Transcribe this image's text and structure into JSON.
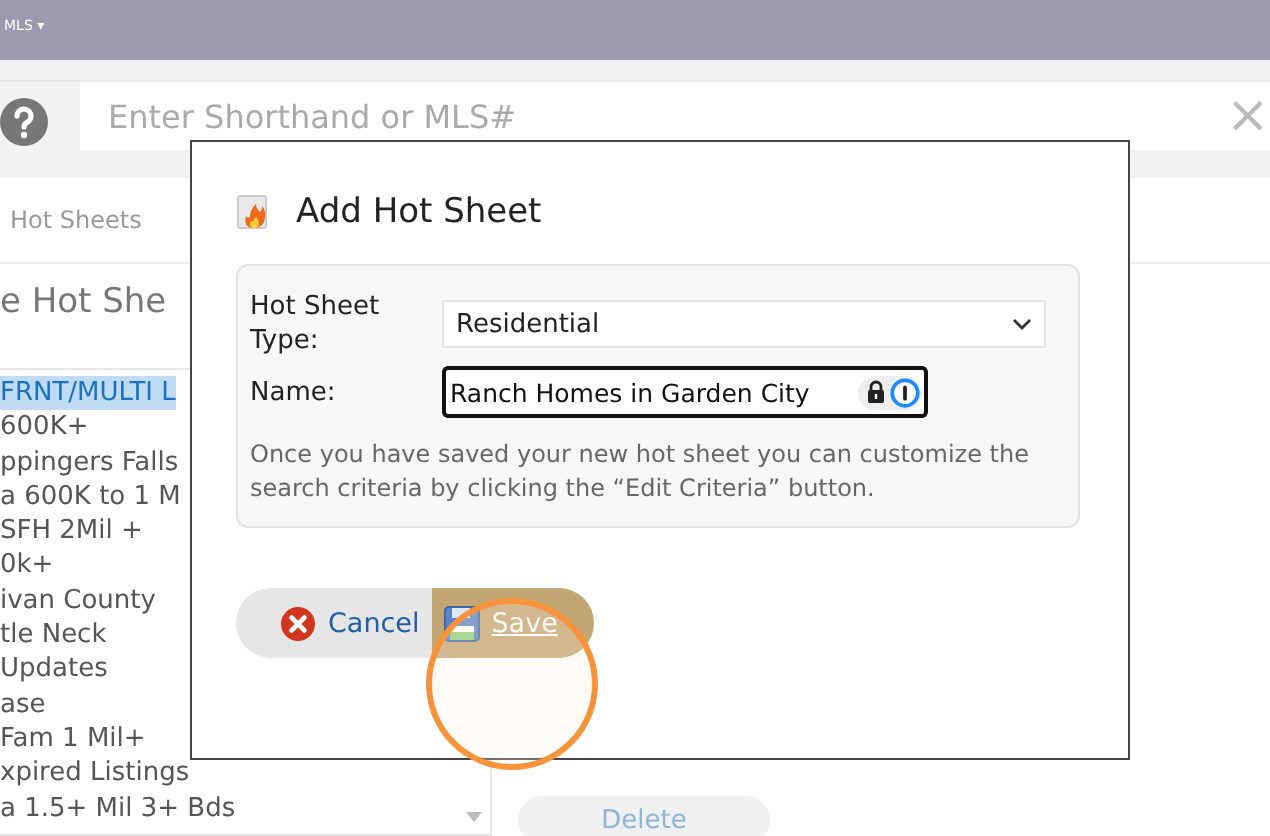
{
  "top_bar": {
    "menu": "MLS ▾"
  },
  "search": {
    "placeholder": "Enter Shorthand or MLS#",
    "clear": "×"
  },
  "tab": "Hot Sheets",
  "heading": "e Hot She",
  "hot_sheet_list": [
    {
      "label": "FRNT/MULTI L",
      "selected": true
    },
    {
      "label": "600K+",
      "selected": false
    },
    {
      "label": "ppingers Falls",
      "selected": false
    },
    {
      "label": "a 600K to 1 M",
      "selected": false
    },
    {
      "label": "SFH 2Mil +",
      "selected": false
    },
    {
      "label": "0k+",
      "selected": false
    },
    {
      "label": "ivan County",
      "selected": false
    },
    {
      "label": "tle Neck",
      "selected": false
    },
    {
      "label": "Updates",
      "selected": false
    },
    {
      "label": "ase",
      "selected": false
    },
    {
      "label": "Fam 1 Mil+",
      "selected": false
    },
    {
      "label": "xpired Listings",
      "selected": false
    },
    {
      "label": "a 1.5+ Mil 3+ Bds",
      "selected": false
    }
  ],
  "delete_button": "Delete",
  "dialog": {
    "title": "Add Hot Sheet",
    "fields": [
      {
        "kind": "select",
        "label": "Hot Sheet Type:",
        "value": "Residential",
        "focused": false
      },
      {
        "kind": "text",
        "label": "Name:",
        "value": "Ranch Homes in Garden City",
        "focused": true
      }
    ],
    "note": "Once you have saved your new hot sheet you can customize the search criteria by clicking the “Edit Criteria” button.",
    "buttons": [
      {
        "kind": "cancel",
        "label": "Cancel",
        "highlighted": false
      },
      {
        "kind": "save",
        "label": "Save",
        "highlighted": true
      }
    ]
  }
}
